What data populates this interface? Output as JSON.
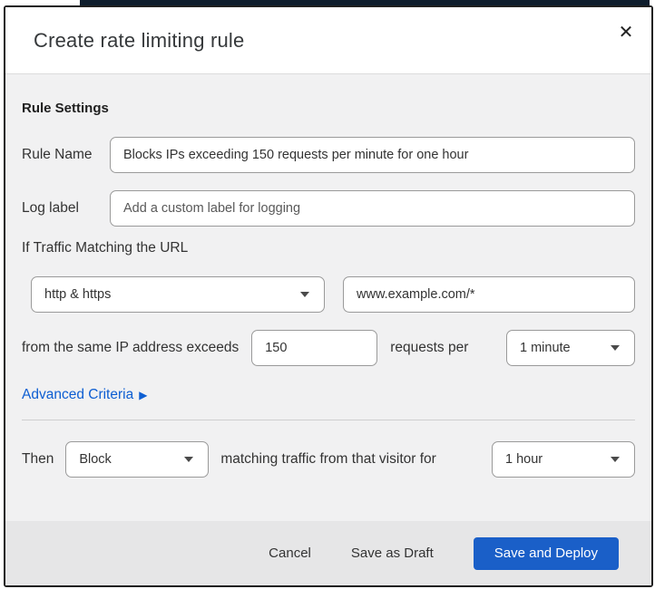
{
  "page": {
    "top_bar_color": "#0e1d2c"
  },
  "modal": {
    "title": "Create rate limiting rule",
    "close_icon": "✕",
    "section_heading": "Rule Settings",
    "rule_name": {
      "label": "Rule Name",
      "value": "Blocks IPs exceeding 150 requests per minute for one hour"
    },
    "log_label": {
      "label": "Log label",
      "placeholder": "Add a custom label for logging"
    },
    "traffic_match": {
      "intro": "If Traffic Matching the URL",
      "scheme_selected": "http & https",
      "url_value": "www.example.com/*",
      "threshold_prefix": "from the same IP address exceeds",
      "threshold_value": "150",
      "threshold_suffix": "requests per",
      "period_selected": "1 minute"
    },
    "advanced": {
      "label": "Advanced Criteria",
      "arrow": "▶",
      "link_color": "#0d5ed2"
    },
    "action": {
      "prefix": "Then",
      "action_selected": "Block",
      "middle": "matching traffic from that visitor for",
      "duration_selected": "1 hour"
    },
    "footer": {
      "cancel_label": "Cancel",
      "save_draft_label": "Save as Draft",
      "save_deploy_label": "Save and Deploy",
      "primary_button_color": "#1a5fc8"
    }
  }
}
